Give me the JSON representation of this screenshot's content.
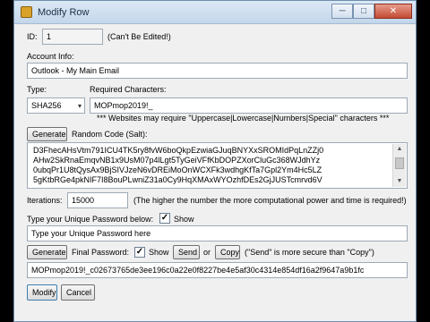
{
  "window": {
    "title": "Modify Row",
    "minimize_label": "─",
    "maximize_label": "□",
    "close_label": "✕"
  },
  "id_section": {
    "label": "ID:",
    "value": "1",
    "note": "(Can't Be Edited!)"
  },
  "account": {
    "label": "Account Info:",
    "value": "Outlook - My Main Email"
  },
  "type": {
    "label": "Type:",
    "selected": "SHA256",
    "arrow": "▾"
  },
  "required": {
    "label": "Required Characters:",
    "value": "MOPmop2019!_",
    "note": "*** Websites may require \"Uppercase|Lowercase|Numbers|Special\" characters ***"
  },
  "salt": {
    "generate_label": "Generate",
    "label": "Random Code (Salt):",
    "lines": [
      "D3FhecAHsVtm791ICU4TK5ry8fvW6boQkpEzwiaGJuqBNYXxSROMIdPqLnZZj0",
      "AHw2SkRnaEmqvNB1x9UsM07p4lLgt5TyGeiVFfKbDOPZXorCluGc368WJdhYz",
      "0ubqPr1U8tQysAx9BjSIVJzeN6vDREiMoOnWCXFk3wdhgKfTa7Gpl2Ym4Hc5LZ",
      "5gKtbRGe4pkNIF7I8BouPLwniZ31a0Cy9HqXMAxWYOzhfDEs2GjJUSTcmrvd6V"
    ],
    "scroll_up": "▲",
    "scroll_down": "▼"
  },
  "iterations": {
    "label": "Iterations:",
    "value": "15000",
    "note": "(The higher the number the more computational power and time is required!)"
  },
  "password": {
    "label": "Type your Unique Password below:",
    "show_label": "Show",
    "show_checked": true,
    "check_mark": "✓",
    "value": "Type your Unique Password here"
  },
  "final": {
    "generate_label": "Generate",
    "label": "Final Password:",
    "show_label": "Show",
    "send_label": "Send",
    "or_label": "or",
    "copy_label": "Copy",
    "note": "(\"Send\" is more secure than \"Copy\")",
    "value": "MOPmop2019!_c02673765de3ee196c0a22e0f8227be4e5af30c4314e854df16a2f9647a9b1fc"
  },
  "actions": {
    "modify_label": "Modify",
    "cancel_label": "Cancel"
  }
}
